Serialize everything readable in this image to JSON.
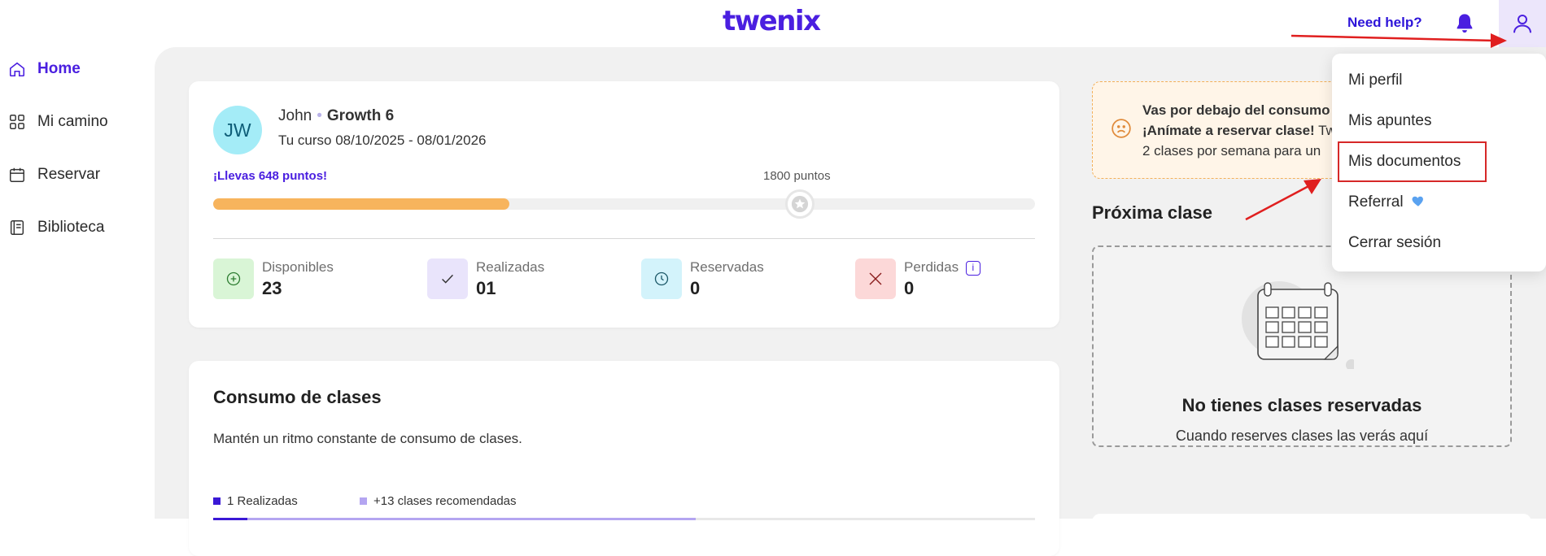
{
  "header": {
    "logo": "twenix",
    "help": "Need help?",
    "brand_color": "#4a1fe0"
  },
  "sidebar": {
    "items": [
      {
        "label": "Home",
        "icon": "home-icon",
        "active": true
      },
      {
        "label": "Mi camino",
        "icon": "grid-icon"
      },
      {
        "label": "Reservar",
        "icon": "calendar-icon"
      },
      {
        "label": "Biblioteca",
        "icon": "book-icon"
      }
    ]
  },
  "profile": {
    "initials": "JW",
    "name": "John",
    "level": "Growth 6",
    "course": "Tu curso 08/10/2025 - 08/01/2026",
    "points_text": "¡Llevas 648 puntos!",
    "goal_text": "1800 puntos",
    "progress_fraction": 0.36
  },
  "stats": [
    {
      "label": "Disponibles",
      "value": "23",
      "icon": "plus-circle-icon",
      "color": "#d9f5d6"
    },
    {
      "label": "Realizadas",
      "value": "01",
      "icon": "check-icon",
      "color": "#e9e4fb"
    },
    {
      "label": "Reservadas",
      "value": "0",
      "icon": "clock-icon",
      "color": "#d3f3fb"
    },
    {
      "label": "Perdidas",
      "value": "0",
      "icon": "x-icon",
      "color": "#fcd8d8"
    }
  ],
  "consumo": {
    "title": "Consumo de clases",
    "description": "Mantén un ritmo constante de consumo de clases.",
    "legend_done": "1 Realizadas",
    "legend_recommended": "+13 clases recomendadas"
  },
  "alert": {
    "line1": "Vas por debajo del consumo",
    "line2_bold": "¡Anímate a reservar clase!",
    "line2_rest": " Tw",
    "line3": "2 clases por semana para un"
  },
  "next_class": {
    "title": "Próxima clase",
    "empty_title": "No tienes clases reservadas",
    "empty_text": "Cuando reserves clases las verás aquí"
  },
  "user_menu": {
    "items": [
      "Mi perfil",
      "Mis apuntes",
      "Mis documentos",
      "Referral",
      "Cerrar sesión"
    ],
    "highlighted": "Mis documentos"
  }
}
